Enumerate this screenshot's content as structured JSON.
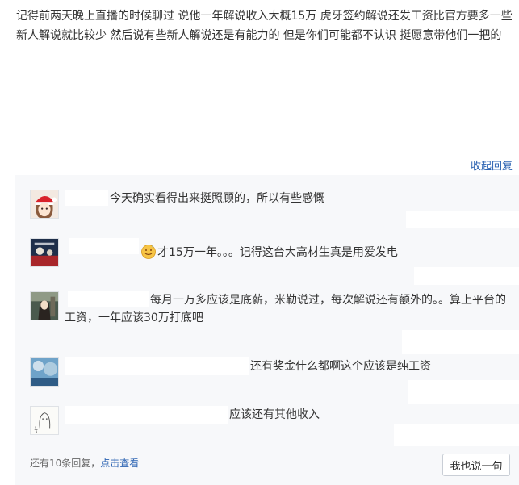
{
  "post": {
    "text": "记得前两天晚上直播的时候聊过 说他一年解说收入大概15万 虎牙签约解说还发工资比官方要多一些 新人解说就比较少 然后说有些新人解说还是有能力的 但是你们可能都不认识 挺愿意带他们一把的"
  },
  "collapse_label": "收起回复",
  "replies": [
    {
      "text": "今天确实看得出来挺照顾的，所以有些感慨",
      "avatar_icon": "anime-girl-santa-hat-avatar"
    },
    {
      "text": "才15万一年。。。记得这台大高材生真是用爱发电",
      "emoji_icon": "sweat-smile-emoji-icon",
      "avatar_icon": "dark-poster-avatar"
    },
    {
      "text": "每月一万多应该是底薪，米勒说过，每次解说还有额外的。。算上平台的工资，一年应该30万打底吧",
      "avatar_icon": "anime-character-avatar"
    },
    {
      "text": "还有奖金什么都啊这个应该是纯工资",
      "avatar_icon": "blue-sky-avatar"
    },
    {
      "text": "应该还有其他收入",
      "avatar_icon": "sketch-drawing-avatar"
    }
  ],
  "footer": {
    "count_text": "还有10条回复，",
    "view_link": "点击查看",
    "reply_button": "我也说一句"
  },
  "colors": {
    "link": "#2d64b3",
    "panel_bg": "#f7f8fa",
    "text": "#333333"
  }
}
